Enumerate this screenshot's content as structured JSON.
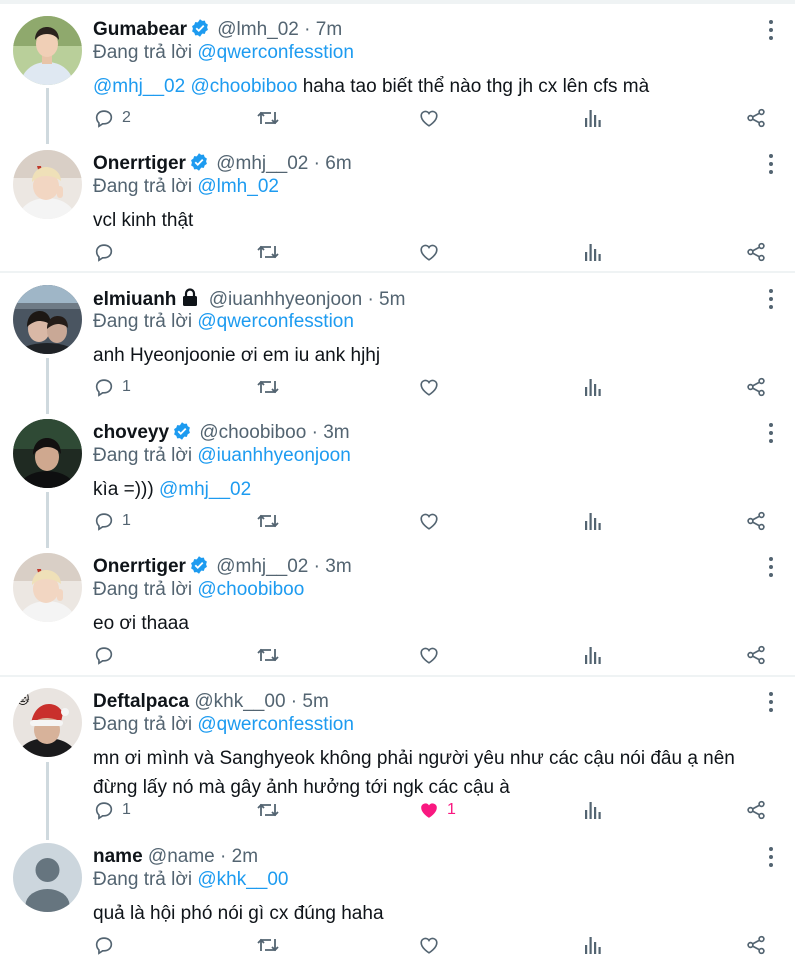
{
  "tweets": [
    {
      "name": "Gumabear",
      "verified": true,
      "locked": false,
      "handle": "@lmh_02",
      "dot": "·",
      "time": "7m",
      "reply_prefix": "Đang trả lời ",
      "reply_to": "@qwerconfesstion",
      "mentions": "@mhj__02 @choobiboo",
      "text": " haha tao biết thể nào thg jh cx lên cfs mà",
      "replies": "2",
      "retweets": "",
      "likes": "",
      "liked": false,
      "avatar": "boy-white-shirt"
    },
    {
      "name": "Onerrtiger",
      "verified": true,
      "locked": false,
      "handle": "@mhj__02",
      "dot": "·",
      "time": "6m",
      "reply_prefix": "Đang trả lời ",
      "reply_to": "@lmh_02",
      "mentions": "",
      "text": "vcl kinh thật",
      "replies": "",
      "retweets": "",
      "likes": "",
      "liked": false,
      "avatar": "blond-peace"
    },
    {
      "name": "elmiuanh",
      "verified": false,
      "locked": true,
      "handle": "@iuanhhyeonjoon",
      "dot": "·",
      "time": "5m",
      "reply_prefix": "Đang trả lời ",
      "reply_to": "@qwerconfesstion",
      "mentions": "",
      "text": "anh Hyeonjoonie ơi em iu ank hjhj",
      "replies": "1",
      "retweets": "",
      "likes": "",
      "liked": false,
      "avatar": "night-couple"
    },
    {
      "name": "choveyy",
      "verified": true,
      "locked": false,
      "handle": "@choobiboo",
      "dot": "·",
      "time": "3m",
      "reply_prefix": "Đang trả lời ",
      "reply_to": "@iuanhhyeonjoon",
      "mentions": "",
      "text": "kìa =))) ",
      "trailing_mention": "@mhj__02",
      "replies": "1",
      "retweets": "",
      "likes": "",
      "liked": false,
      "avatar": "dark-boy"
    },
    {
      "name": "Onerrtiger",
      "verified": true,
      "locked": false,
      "handle": "@mhj__02",
      "dot": "·",
      "time": "3m",
      "reply_prefix": "Đang trả lời ",
      "reply_to": "@choobiboo",
      "mentions": "",
      "text": "eo ơi thaaa",
      "replies": "",
      "retweets": "",
      "likes": "",
      "liked": false,
      "avatar": "blond-peace"
    },
    {
      "name": "Deftalpaca",
      "verified": false,
      "locked": false,
      "handle": "@khk__00",
      "dot": "·",
      "time": "5m",
      "reply_prefix": "Đang trả lời ",
      "reply_to": "@qwerconfesstion",
      "mentions": "",
      "text": "mn ơi mình và Sanghyeok không phải người yêu như các cậu nói đâu ạ nên đừng lấy nó mà gây ảnh hưởng tới ngk các cậu à",
      "replies": "1",
      "retweets": "",
      "likes": "1",
      "liked": true,
      "avatar": "santa-hat"
    },
    {
      "name": "name",
      "verified": false,
      "locked": false,
      "handle": "@name",
      "dot": "·",
      "time": "2m",
      "reply_prefix": "Đang trả lời ",
      "reply_to": "@khk__00",
      "mentions": "",
      "text": "quả là hội phó nói gì cx đúng haha",
      "replies": "",
      "retweets": "",
      "likes": "",
      "liked": false,
      "avatar": "default"
    }
  ],
  "colors": {
    "accent": "#1d9bf0",
    "muted": "#536471",
    "like": "#f91880",
    "divider": "#eff3f4",
    "thread": "#cfd9de"
  },
  "icons": [
    "verified-badge-icon",
    "lock-icon",
    "more-icon",
    "reply-icon",
    "retweet-icon",
    "like-icon",
    "views-icon",
    "share-icon"
  ]
}
